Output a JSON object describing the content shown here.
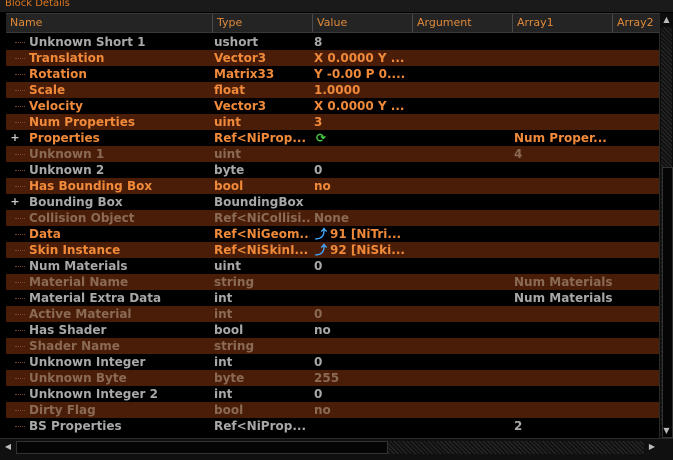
{
  "panel_title": "Block Details",
  "columns": [
    {
      "label": "Name"
    },
    {
      "label": "Type"
    },
    {
      "label": "Value"
    },
    {
      "label": "Argument"
    },
    {
      "label": "Array1"
    },
    {
      "label": "Array2"
    }
  ],
  "rows": [
    {
      "name": "Unknown Short 1",
      "type": "ushort",
      "value": "8",
      "array1": "",
      "style": "gray",
      "expander": "",
      "icon": ""
    },
    {
      "name": "Translation",
      "type": "Vector3",
      "value": "X 0.0000 Y ...",
      "array1": "",
      "style": "orange",
      "expander": "",
      "icon": ""
    },
    {
      "name": "Rotation",
      "type": "Matrix33",
      "value": "Y -0.00 P 0....",
      "array1": "",
      "style": "orange",
      "expander": "",
      "icon": ""
    },
    {
      "name": "Scale",
      "type": "float",
      "value": "1.0000",
      "array1": "",
      "style": "orange",
      "expander": "",
      "icon": ""
    },
    {
      "name": "Velocity",
      "type": "Vector3",
      "value": "X 0.0000 Y ...",
      "array1": "",
      "style": "orange",
      "expander": "",
      "icon": ""
    },
    {
      "name": "Num Properties",
      "type": "uint",
      "value": "3",
      "array1": "",
      "style": "orange",
      "expander": "",
      "icon": ""
    },
    {
      "name": "Properties",
      "type": "Ref<NiProp...",
      "value": "",
      "array1": "Num Proper...",
      "style": "orange",
      "expander": "+",
      "icon": "refresh-icon"
    },
    {
      "name": "Unknown 1",
      "type": "uint",
      "value": "",
      "array1": "4",
      "style": "dim",
      "expander": "",
      "icon": ""
    },
    {
      "name": "Unknown 2",
      "type": "byte",
      "value": "0",
      "array1": "",
      "style": "gray",
      "expander": "",
      "icon": ""
    },
    {
      "name": "Has Bounding Box",
      "type": "bool",
      "value": "no",
      "array1": "",
      "style": "orange",
      "expander": "",
      "icon": ""
    },
    {
      "name": "Bounding Box",
      "type": "BoundingBox",
      "value": "",
      "array1": "",
      "style": "gray",
      "expander": "+",
      "icon": ""
    },
    {
      "name": "Collision Object",
      "type": "Ref<NiCollisi...",
      "value": "None",
      "array1": "",
      "style": "dim",
      "expander": "",
      "icon": ""
    },
    {
      "name": "Data",
      "type": "Ref<NiGeom...",
      "value": "91 [NiTri...",
      "array1": "",
      "style": "orange",
      "expander": "",
      "icon": "link-icon"
    },
    {
      "name": "Skin Instance",
      "type": "Ref<NiSkinI...",
      "value": "92 [NiSki...",
      "array1": "",
      "style": "orange",
      "expander": "",
      "icon": "link-icon"
    },
    {
      "name": "Num Materials",
      "type": "uint",
      "value": "0",
      "array1": "",
      "style": "gray",
      "expander": "",
      "icon": ""
    },
    {
      "name": "Material Name",
      "type": "string",
      "value": "",
      "array1": "Num Materials",
      "style": "dim",
      "expander": "",
      "icon": ""
    },
    {
      "name": "Material Extra Data",
      "type": "int",
      "value": "",
      "array1": "Num Materials",
      "style": "gray",
      "expander": "",
      "icon": ""
    },
    {
      "name": "Active Material",
      "type": "int",
      "value": "0",
      "array1": "",
      "style": "dim",
      "expander": "",
      "icon": ""
    },
    {
      "name": "Has Shader",
      "type": "bool",
      "value": "no",
      "array1": "",
      "style": "gray",
      "expander": "",
      "icon": ""
    },
    {
      "name": "Shader Name",
      "type": "string",
      "value": "",
      "array1": "",
      "style": "dim",
      "expander": "",
      "icon": ""
    },
    {
      "name": "Unknown Integer",
      "type": "int",
      "value": "0",
      "array1": "",
      "style": "gray",
      "expander": "",
      "icon": ""
    },
    {
      "name": "Unknown Byte",
      "type": "byte",
      "value": "255",
      "array1": "",
      "style": "dim",
      "expander": "",
      "icon": ""
    },
    {
      "name": "Unknown Integer 2",
      "type": "int",
      "value": "0",
      "array1": "",
      "style": "gray",
      "expander": "",
      "icon": ""
    },
    {
      "name": "Dirty Flag",
      "type": "bool",
      "value": "no",
      "array1": "",
      "style": "dim",
      "expander": "",
      "icon": ""
    },
    {
      "name": "BS Properties",
      "type": "Ref<NiProp...",
      "value": "",
      "array1": "2",
      "style": "gray",
      "expander": "",
      "icon": ""
    }
  ],
  "colors": {
    "accent": "#f08a3a",
    "row_alt": "#4a1d08",
    "text_gray": "#a8a8a8"
  }
}
